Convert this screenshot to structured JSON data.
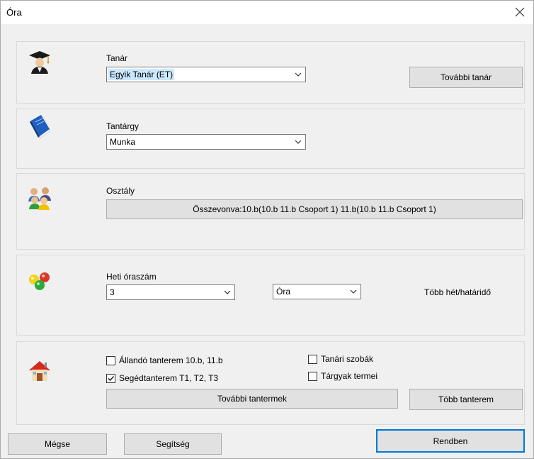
{
  "window": {
    "title": "Óra"
  },
  "teacher": {
    "label": "Tanár",
    "selected": "Egyik Tanár (ET)",
    "more_button": "További tanár"
  },
  "subject": {
    "label": "Tantárgy",
    "selected": "Munka"
  },
  "class": {
    "label": "Osztály",
    "button": "Összevonva:10.b(10.b 11.b Csoport 1) 11.b(10.b 11.b Csoport 1)"
  },
  "hours": {
    "label": "Heti óraszám",
    "count_selected": "3",
    "unit_selected": "Óra",
    "multi_week_label": "Több hét/határidő"
  },
  "rooms": {
    "permanent_room": {
      "label": "Állandó tanterem 10.b, 11.b",
      "checked": false
    },
    "aux_room": {
      "label": "Segédtanterem T1, T2, T3",
      "checked": true
    },
    "staff_rooms": {
      "label": "Tanári szobák",
      "checked": false
    },
    "subject_rooms": {
      "label": "Tárgyak termei",
      "checked": false
    },
    "more_rooms_button": "További tantermek",
    "multiple_rooms_button": "Több tanterem"
  },
  "footer": {
    "cancel": "Mégse",
    "help": "Segítség",
    "ok": "Rendben"
  }
}
